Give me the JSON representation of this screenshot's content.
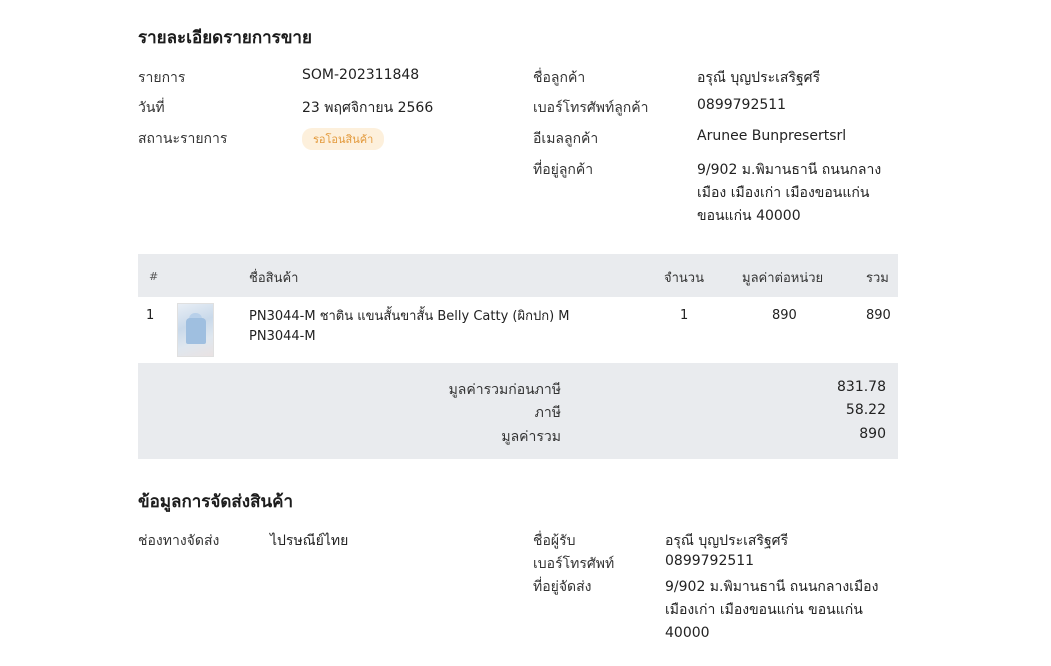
{
  "order": {
    "section_title": "รายละเอียดรายการขาย",
    "left": [
      {
        "label": "รายการ",
        "value": "SOM-202311848"
      },
      {
        "label": "วันที่",
        "value": "23 พฤศจิกายน 2566"
      },
      {
        "label": "สถานะรายการ",
        "badge": "รอโอนสินค้า"
      }
    ],
    "right": [
      {
        "label": "ชื่อลูกค้า",
        "value": "อรุณี บุญประเสริฐศรี"
      },
      {
        "label": "เบอร์โทรศัพท์ลูกค้า",
        "value": "0899792511"
      },
      {
        "label": "อีเมลลูกค้า",
        "value": "Arunee Bunpresertsrl"
      },
      {
        "label": "ที่อยู่ลูกค้า",
        "lines": [
          "9/902 ม.พิมานธานี ถนนกลาง",
          "เมือง เมืองเก่า เมืองขอนแก่น",
          "ขอนแก่น 40000"
        ]
      }
    ]
  },
  "table": {
    "headers": {
      "num": "#",
      "name": "ชื่อสินค้า",
      "qty": "จำนวน",
      "unit": "มูลค่าต่อหน่วย",
      "total": "รวม"
    },
    "rows": [
      {
        "num": "1",
        "name_lines": [
          "PN3044-M ชาติน แขนสั้นขาสั้น Belly Catty (ผิกปก) M",
          "PN3044-M"
        ],
        "qty": "1",
        "unit": "890",
        "total": "890",
        "thumb_icon": "product-photo"
      }
    ]
  },
  "summary": {
    "subtotal_label": "มูลค่ารวมก่อนภาษี",
    "subtotal": "831.78",
    "tax_label": "ภาษี",
    "tax": "58.22",
    "total_label": "มูลค่ารวม",
    "total": "890"
  },
  "shipping": {
    "section_title": "ข้อมูลการจัดส่งสินค้า",
    "channel_label": "ช่องทางจัดส่ง",
    "channel_value": "ไปรษณีย์ไทย",
    "receiver_label": "ชื่อผู้รับ",
    "receiver_value": "อรุณี บุญประเสริฐศรี",
    "phone_label": "เบอร์โทรศัพท์",
    "phone_value": "0899792511",
    "address_label": "ที่อยู่จัดส่ง",
    "address_lines": [
      "9/902 ม.พิมานธานี ถนนกลางเมือง",
      "เมืองเก่า เมืองขอนแก่น ขอนแก่น",
      "40000"
    ]
  },
  "colors": {
    "badge_bg": "#fdf0dc",
    "badge_text": "#e39a3c",
    "table_header_bg": "#e9ebee"
  }
}
